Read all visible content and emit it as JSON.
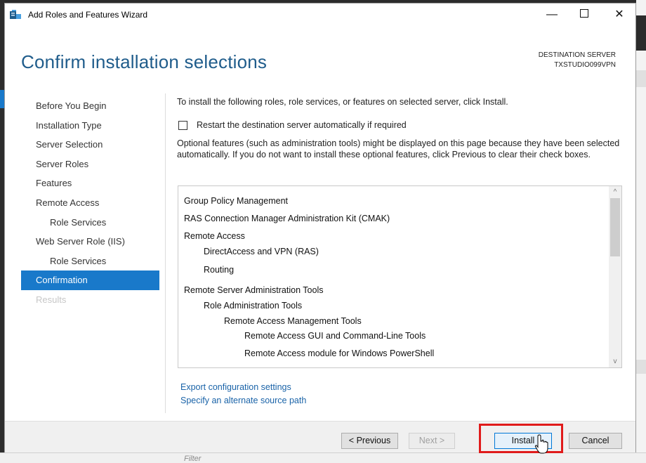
{
  "window": {
    "title": "Add Roles and Features Wizard",
    "minimize_glyph": "—",
    "close_glyph": "✕"
  },
  "page": {
    "title": "Confirm installation selections",
    "destination_label": "DESTINATION SERVER",
    "destination_server": "TXSTUDIO099VPN"
  },
  "nav": {
    "items": [
      {
        "label": "Before You Begin",
        "state": "normal"
      },
      {
        "label": "Installation Type",
        "state": "normal"
      },
      {
        "label": "Server Selection",
        "state": "normal"
      },
      {
        "label": "Server Roles",
        "state": "normal"
      },
      {
        "label": "Features",
        "state": "normal"
      },
      {
        "label": "Remote Access",
        "state": "normal"
      },
      {
        "label": "Role Services",
        "state": "sub"
      },
      {
        "label": "Web Server Role (IIS)",
        "state": "normal"
      },
      {
        "label": "Role Services",
        "state": "sub"
      },
      {
        "label": "Confirmation",
        "state": "active"
      },
      {
        "label": "Results",
        "state": "disabled"
      }
    ]
  },
  "main": {
    "intro": "To install the following roles, role services, or features on selected server, click Install.",
    "restart_label": "Restart the destination server automatically if required",
    "restart_checked": false,
    "optional_text": "Optional features (such as administration tools) might be displayed on this page because they have been selected automatically. If you do not want to install these optional features, click Previous to clear their check boxes.",
    "features": [
      "Group Policy Management",
      "RAS Connection Manager Administration Kit (CMAK)",
      "Remote Access",
      "DirectAccess and VPN (RAS)",
      "Routing",
      "Remote Server Administration Tools",
      "Role Administration Tools",
      "Remote Access Management Tools",
      "Remote Access GUI and Command-Line Tools",
      "Remote Access module for Windows PowerShell"
    ],
    "scroll_up_glyph": "^",
    "scroll_down_glyph": "v",
    "export_link": "Export configuration settings",
    "source_link": "Specify an alternate source path"
  },
  "footer": {
    "previous": "< Previous",
    "next": "Next >",
    "install": "Install",
    "cancel": "Cancel"
  },
  "background": {
    "filter_placeholder": "Filter"
  },
  "colors": {
    "accent": "#1979ca",
    "title": "#1f5c8b",
    "link": "#1a63a8",
    "highlight": "#e01b1b"
  }
}
